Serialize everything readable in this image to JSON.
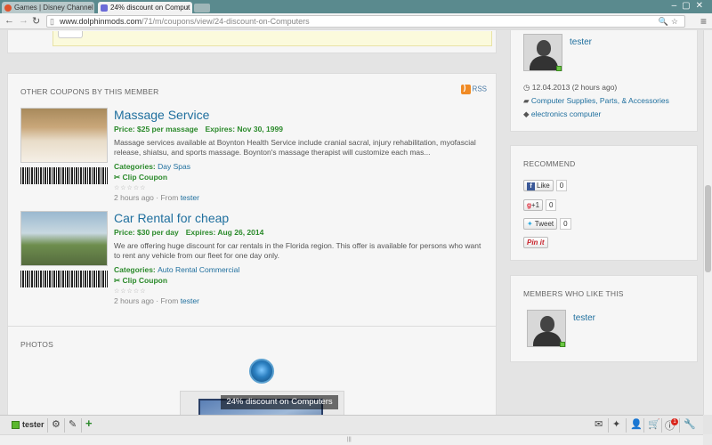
{
  "browser": {
    "tabs": [
      {
        "title": "Games | Disney Channel T"
      },
      {
        "title": "24% discount on Comput"
      }
    ],
    "url_host": "www.dolphinmods.com",
    "url_path": "/71/m/coupons/view/24-discount-on-Computers",
    "icons": [
      "back-icon",
      "forward-icon",
      "zoom-icon",
      "star-icon",
      "menu-icon"
    ]
  },
  "other_coupons": {
    "heading": "OTHER COUPONS BY THIS MEMBER",
    "rss_label": "RSS",
    "items": [
      {
        "title": "Massage Service",
        "price": "Price: $25 per massage",
        "expires": "Expires: Nov 30, 1999",
        "description": "Massage services available at Boynton Health Service include cranial sacral, injury rehabilitation, myofascial release, shiatsu, and sports massage. Boynton's massage therapist will customize each mas...",
        "category_label": "Categories:",
        "category": "Day Spas",
        "clip": "Clip Coupon",
        "time": "2 hours ago",
        "from_label": "From",
        "author": "tester"
      },
      {
        "title": "Car Rental for cheap",
        "price": "Price: $30 per day",
        "expires": "Expires: Aug 26, 2014",
        "description": "We are offering huge discount for car rentals in the Florida region. This offer is available for persons who want to rent any vehicle from our fleet for one day only.",
        "category_label": "Categories:",
        "category": "Auto Rental Commercial",
        "clip": "Clip Coupon",
        "time": "2 hours ago",
        "from_label": "From",
        "author": "tester"
      }
    ]
  },
  "photos": {
    "heading": "PHOTOS",
    "caption": "24% discount on Computers"
  },
  "sidebar": {
    "owner": {
      "name": "tester",
      "date": "12.04.2013 (2 hours ago)",
      "category": "Computer Supplies, Parts, & Accessories",
      "tags": "electronics computer"
    },
    "recommend": {
      "heading": "RECOMMEND",
      "facebook_label": "Like",
      "facebook_count": "0",
      "gplus_label": "+1",
      "gplus_count": "0",
      "tweet_label": "Tweet",
      "tweet_count": "0",
      "pinit_label": "Pin it"
    },
    "likes": {
      "heading": "MEMBERS WHO LIKE THIS",
      "member": "tester"
    }
  },
  "bottom_bar": {
    "user": "tester",
    "notification_count": "1"
  },
  "colors": {
    "link": "#1f6f9e",
    "green": "#2b8a2b",
    "online": "#6cc644"
  }
}
